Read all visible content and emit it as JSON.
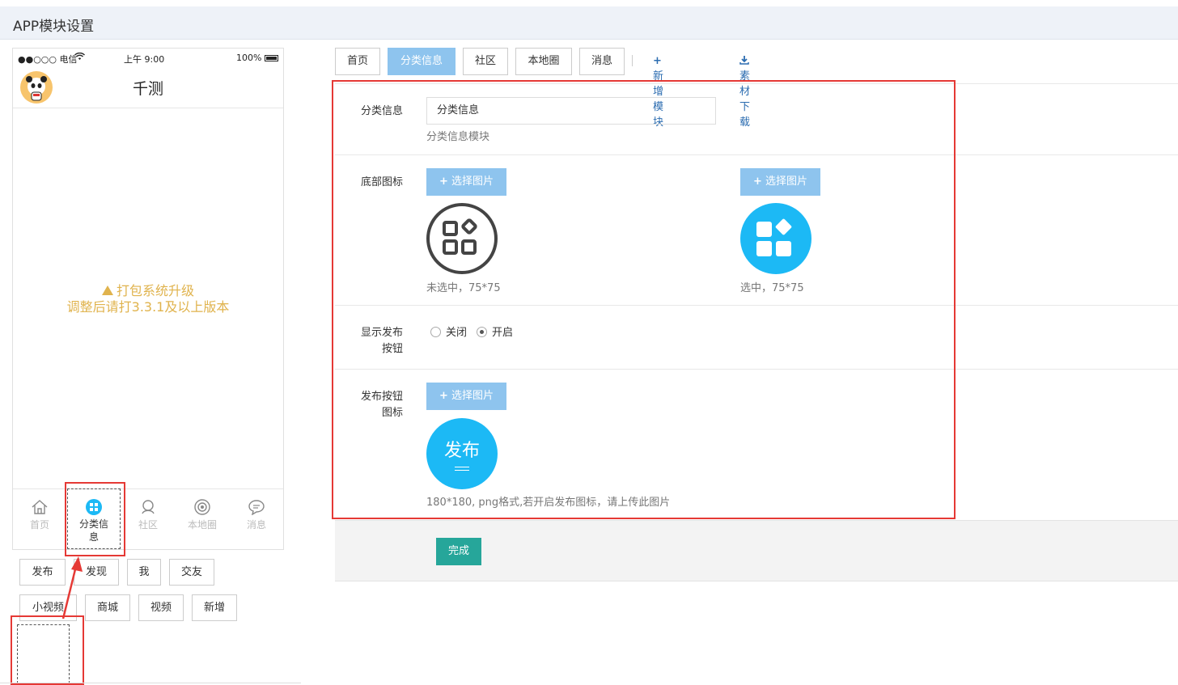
{
  "window": {
    "title": "APP模块设置"
  },
  "phone": {
    "status": {
      "carrier": "●●○○○ 电信",
      "time": "上午 9:00",
      "battery": "100%"
    },
    "title": "千测",
    "notice": {
      "line1": "打包系统升级",
      "line2": "调整后请打3.3.1及以上版本"
    },
    "tabs": [
      {
        "label": "首页",
        "icon": "home-icon"
      },
      {
        "label": "分类信息",
        "icon": "category-icon",
        "active": true
      },
      {
        "label": "社区",
        "icon": "community-icon"
      },
      {
        "label": "本地圈",
        "icon": "local-circle-icon"
      },
      {
        "label": "消息",
        "icon": "message-icon"
      }
    ]
  },
  "chips_row1": [
    "发布",
    "发现",
    "我",
    "交友"
  ],
  "chips_row2": [
    "小视频",
    "商城",
    "视频",
    "新增"
  ],
  "module_tabs": [
    "首页",
    "分类信息",
    "社区",
    "本地圈",
    "消息"
  ],
  "active_module": "分类信息",
  "links": {
    "add_module": "新增模块",
    "download": "素材下载"
  },
  "form": {
    "name": {
      "label": "分类信息",
      "value": "分类信息",
      "hint": "分类信息模块"
    },
    "icon": {
      "label": "底部图标",
      "pick_label": "选择图片",
      "unselected_hint": "未选中，75*75",
      "selected_hint": "选中，75*75"
    },
    "publish": {
      "label_line1": "显示发布",
      "label_line2": "按钮",
      "off": "关闭",
      "on": "开启",
      "value": "开启"
    },
    "publish_icon": {
      "label_line1": "发布按钮",
      "label_line2": "图标",
      "pick_label": "选择图片",
      "image_text": "发布",
      "hint": "180*180, png格式,若开启发布图标，请上传此图片"
    }
  },
  "submit_label": "完成",
  "colors": {
    "accent": "#8ec4ee",
    "icon_blue": "#1cb9f5",
    "submit": "#26a69a",
    "annotation": "#e53935",
    "notice": "#e0b34d"
  }
}
